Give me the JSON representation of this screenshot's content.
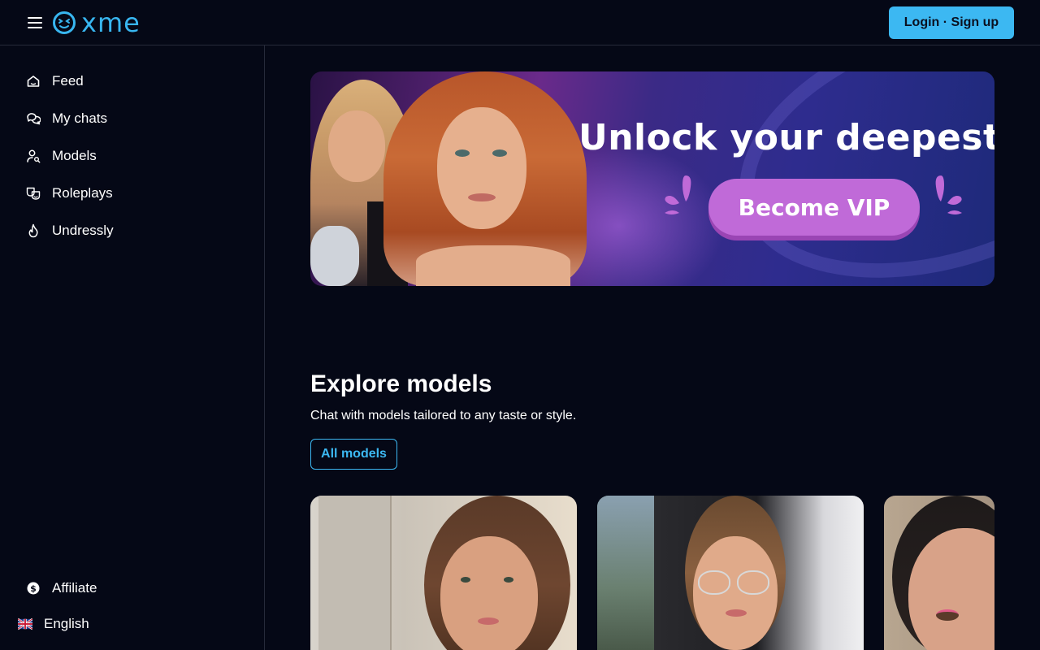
{
  "header": {
    "logo_text": "xme",
    "login_label": "Login · Sign up",
    "accent_color": "#3cb8f2"
  },
  "sidebar": {
    "items": [
      {
        "label": "Feed",
        "icon": "home-icon"
      },
      {
        "label": "My chats",
        "icon": "chat-bubbles-icon"
      },
      {
        "label": "Models",
        "icon": "user-search-icon"
      },
      {
        "label": "Roleplays",
        "icon": "masks-icon"
      },
      {
        "label": "Undressly",
        "icon": "flame-icon"
      }
    ],
    "footer": {
      "affiliate_label": "Affiliate",
      "affiliate_icon": "dollar-circle-icon",
      "language_label": "English",
      "language_icon": "uk-flag-icon"
    }
  },
  "banner": {
    "title": "Unlock your deepest desi",
    "cta_label": "Become VIP"
  },
  "explore": {
    "title": "Explore models",
    "subtitle": "Chat with models tailored to any taste or style.",
    "all_models_label": "All models"
  },
  "model_cards": [
    {
      "name": "model-card-1"
    },
    {
      "name": "model-card-2"
    },
    {
      "name": "model-card-3"
    }
  ]
}
